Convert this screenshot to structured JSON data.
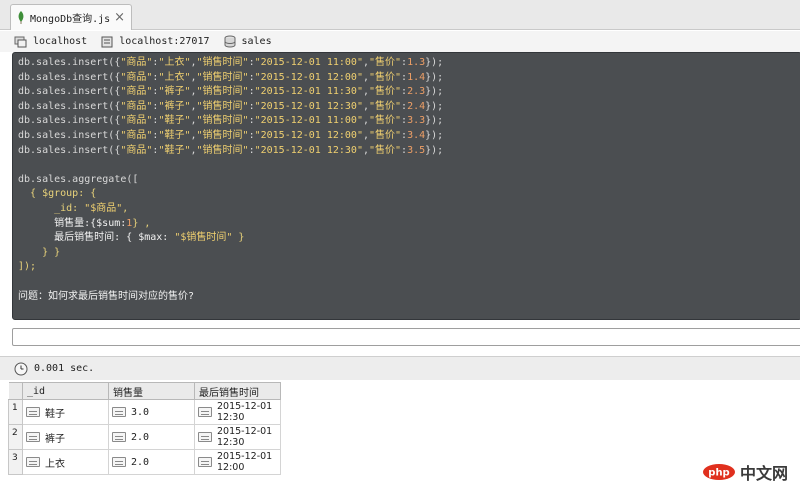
{
  "tab": {
    "title": "MongoDb查询.js",
    "close": "×"
  },
  "connection": {
    "host": "localhost",
    "server": "localhost:27017",
    "database": "sales"
  },
  "editor": {
    "insert_lines": [
      {
        "prefix": "db.sales.insert({",
        "product_key": "\"商品\"",
        "product": "\"上衣\"",
        "time_key": "\"销售时间\"",
        "time": "\"2015-12-01 11:00\"",
        "price_key": "\"售价\"",
        "price": "1.3",
        "suffix": "});"
      },
      {
        "prefix": "db.sales.insert({",
        "product_key": "\"商品\"",
        "product": "\"上衣\"",
        "time_key": "\"销售时间\"",
        "time": "\"2015-12-01 12:00\"",
        "price_key": "\"售价\"",
        "price": "1.4",
        "suffix": "});"
      },
      {
        "prefix": "db.sales.insert({",
        "product_key": "\"商品\"",
        "product": "\"裤子\"",
        "time_key": "\"销售时间\"",
        "time": "\"2015-12-01 11:30\"",
        "price_key": "\"售价\"",
        "price": "2.3",
        "suffix": "});"
      },
      {
        "prefix": "db.sales.insert({",
        "product_key": "\"商品\"",
        "product": "\"裤子\"",
        "time_key": "\"销售时间\"",
        "time": "\"2015-12-01 12:30\"",
        "price_key": "\"售价\"",
        "price": "2.4",
        "suffix": "});"
      },
      {
        "prefix": "db.sales.insert({",
        "product_key": "\"商品\"",
        "product": "\"鞋子\"",
        "time_key": "\"销售时间\"",
        "time": "\"2015-12-01 11:00\"",
        "price_key": "\"售价\"",
        "price": "3.3",
        "suffix": "});"
      },
      {
        "prefix": "db.sales.insert({",
        "product_key": "\"商品\"",
        "product": "\"鞋子\"",
        "time_key": "\"销售时间\"",
        "time": "\"2015-12-01 12:00\"",
        "price_key": "\"售价\"",
        "price": "3.4",
        "suffix": "});"
      },
      {
        "prefix": "db.sales.insert({",
        "product_key": "\"商品\"",
        "product": "\"鞋子\"",
        "time_key": "\"销售时间\"",
        "time": "\"2015-12-01 12:30\"",
        "price_key": "\"售价\"",
        "price": "3.5",
        "suffix": "});"
      }
    ],
    "aggregate": {
      "open": "db.sales.aggregate([",
      "group_open": "  { $group: {",
      "id_key": "      _id: ",
      "id_val": "\"$商品\"",
      "id_end": ",",
      "qty_key": "      销售量:{$sum:",
      "qty_num": "1",
      "qty_end": "} ,",
      "time_key": "      最后销售时间: { $max: ",
      "time_val": "\"$销售时间\"",
      "time_end": " }",
      "group_close": "    } }",
      "close": "]);"
    },
    "question": "问题：如何求最后销售时间对应的售价?"
  },
  "status": {
    "elapsed": "0.001 sec."
  },
  "results": {
    "headers": [
      "_id",
      "销售量",
      "最后销售时间"
    ],
    "rows": [
      {
        "n": "1",
        "id": "鞋子",
        "qty": "3.0",
        "time_date": "2015-12-01",
        "time_clock": "12:30"
      },
      {
        "n": "2",
        "id": "裤子",
        "qty": "2.0",
        "time_date": "2015-12-01",
        "time_clock": "12:30"
      },
      {
        "n": "3",
        "id": "上衣",
        "qty": "2.0",
        "time_date": "2015-12-01",
        "time_clock": "12:00"
      }
    ]
  },
  "watermark": {
    "logo": "php",
    "text": "中文网"
  },
  "colors": {
    "editor_bg": "#4b4e51",
    "string": "#f0d070",
    "number": "#ee9f66",
    "leaf": "#3f8f3a"
  }
}
